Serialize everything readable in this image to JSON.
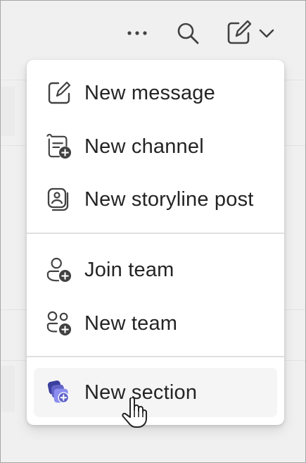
{
  "toolbar": {
    "more_icon": "more-horizontal-icon",
    "search_icon": "search-icon",
    "compose_icon": "compose-icon",
    "chevron_icon": "chevron-down-icon"
  },
  "menu": {
    "items": [
      {
        "label": "New message",
        "icon": "compose-icon"
      },
      {
        "label": "New channel",
        "icon": "channel-add-icon"
      },
      {
        "label": "New storyline post",
        "icon": "storyline-icon"
      },
      {
        "label": "Join team",
        "icon": "person-add-icon"
      },
      {
        "label": "New team",
        "icon": "people-add-icon"
      },
      {
        "label": "New section",
        "icon": "section-add-icon"
      }
    ]
  },
  "colors": {
    "text": "#242424",
    "icon": "#424242",
    "accent_section_icon": "#5b5fc7",
    "menu_background": "#ffffff",
    "hover_background": "#f5f5f5",
    "page_background": "#f0f0f0"
  }
}
